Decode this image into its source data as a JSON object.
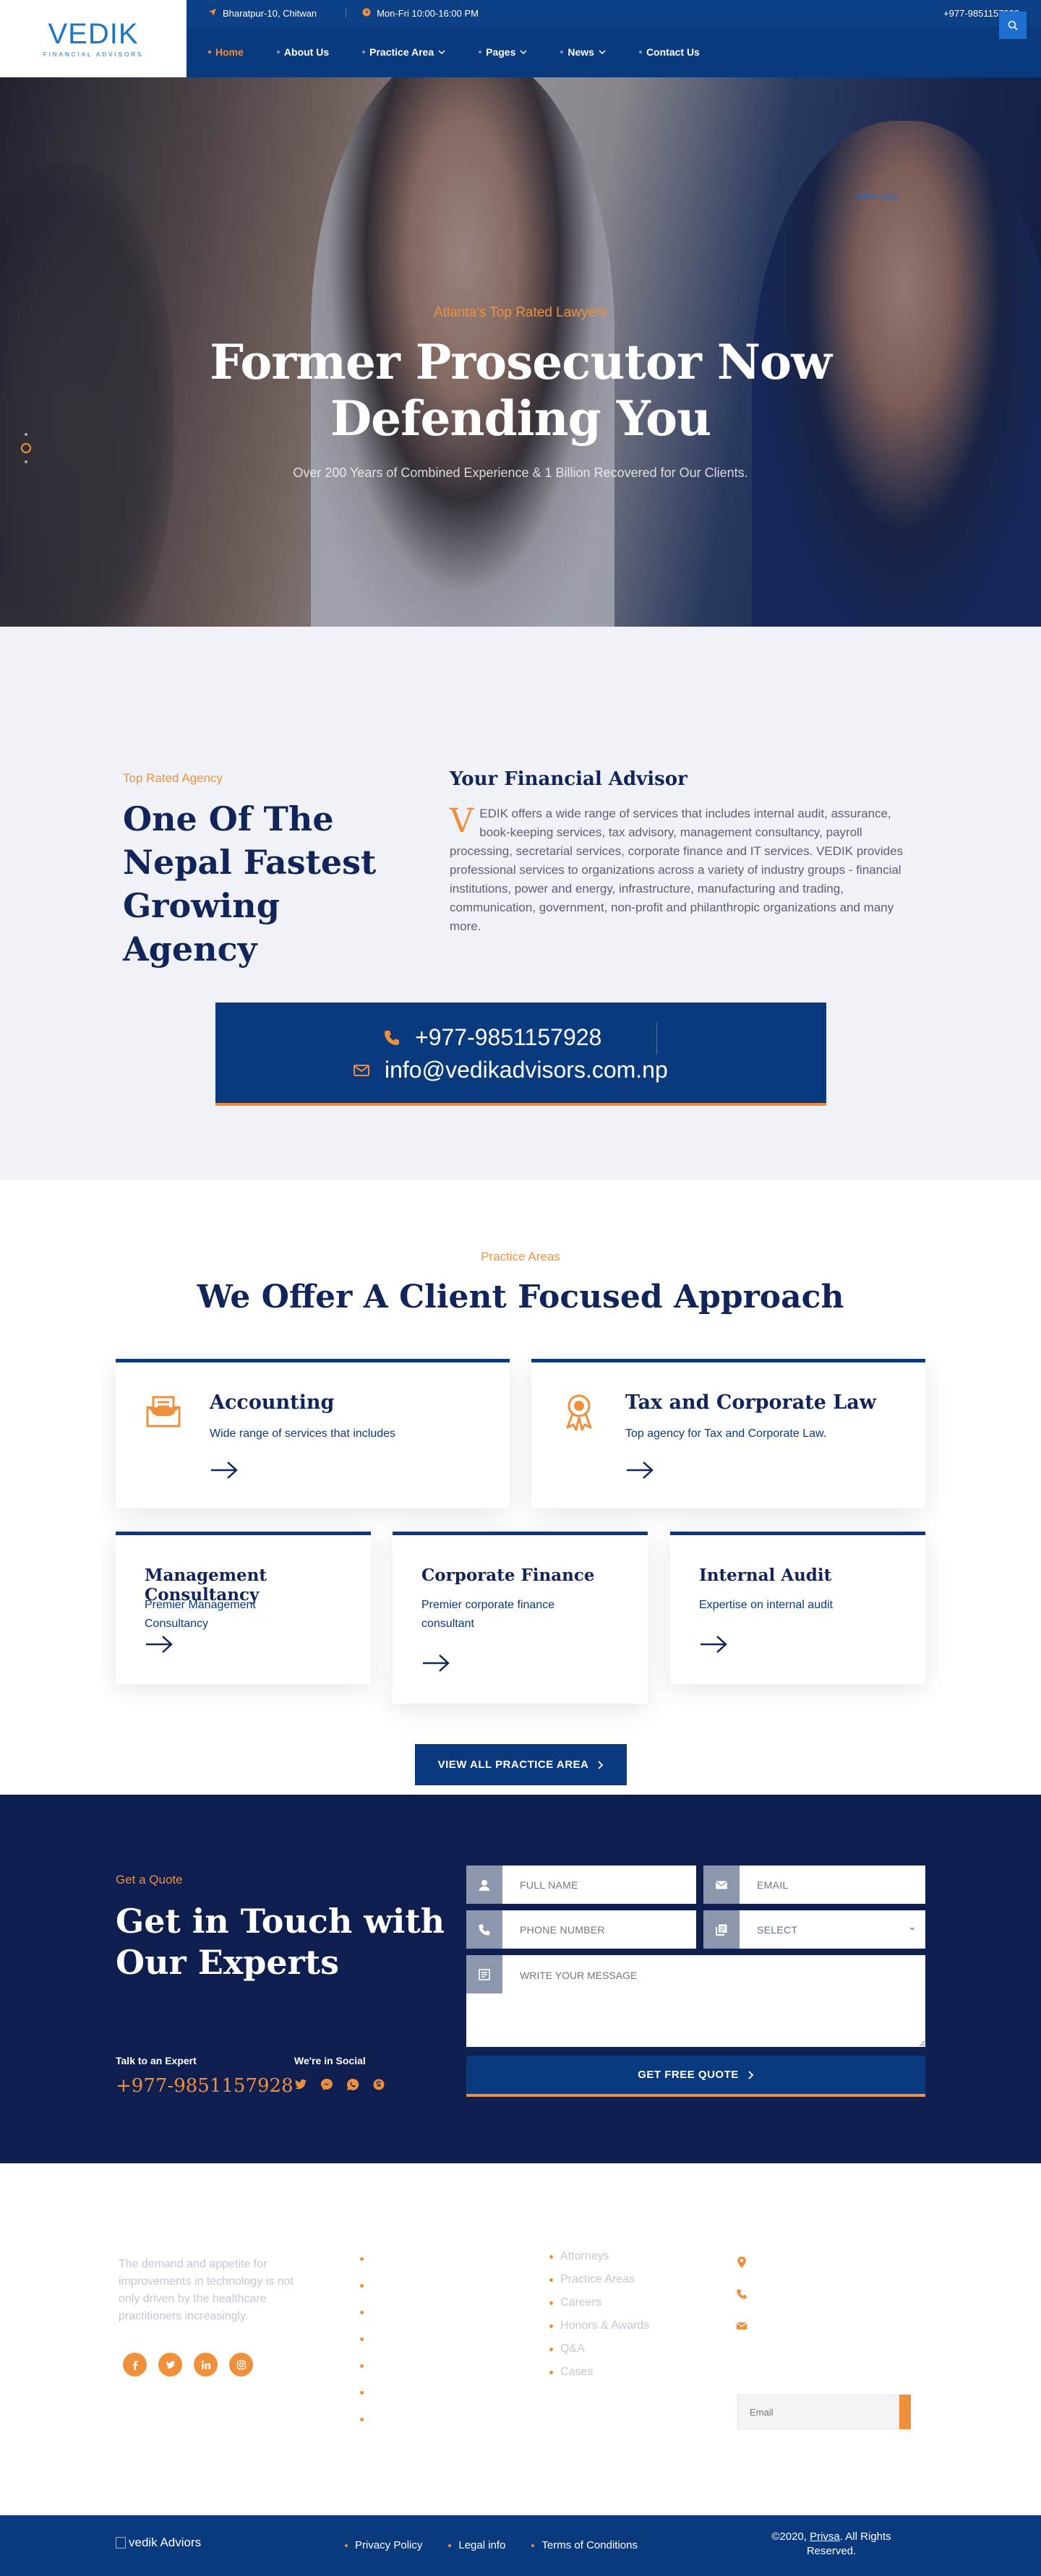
{
  "brand": {
    "logo_text": "VEDIK",
    "logo_sub": "FINANCIAL ADVISORS",
    "accent": "#f0903d",
    "primary": "#0a3a7e",
    "dark": "#0d1e4f"
  },
  "topbar": {
    "address": "Bharatpur-10, Chitwan",
    "hours": "Mon-Fri 10:00-16:00 PM",
    "phone": "+977-9851157928"
  },
  "nav": {
    "items": [
      {
        "label": "Home",
        "active": true
      },
      {
        "label": "About Us"
      },
      {
        "label": "Practice Area",
        "dropdown": true
      },
      {
        "label": "Pages",
        "dropdown": true
      },
      {
        "label": "News",
        "dropdown": true
      },
      {
        "label": "Contact Us"
      }
    ]
  },
  "hero": {
    "tagline": "Atlanta's Top Rated Lawyers",
    "title_line1": "Former Prosecutor Now",
    "title_line2": "Defending You",
    "subtitle": "Over 200 Years of Combined Experience & 1 Billion Recovered for Our Clients.",
    "image_alt": "slider-img"
  },
  "about": {
    "tag": "Top Rated Agency",
    "title": "One Of The Nepal Fastest Growing Agency",
    "advisor_title": "Your Financial Advisor",
    "dropcap": "V",
    "advisor_text": "EDIK offers a wide range of services that includes internal audit, assurance, book-keeping services, tax advisory, management consultancy, payroll processing, secretarial services, corporate finance and IT services. VEDIK provides professional services to organizations across a variety of industry groups - financial institutions, power and energy, infrastructure, manufacturing and trading, communication, government, non-profit and philanthropic organizations and many more.",
    "phone": "+977-9851157928",
    "email": "info@vedikadvisors.com.np"
  },
  "practice": {
    "tag": "Practice Areas",
    "title": "We Offer A Client Focused Approach",
    "cards": [
      {
        "title": "Accounting",
        "desc": "Wide range of services that includes"
      },
      {
        "title": "Tax and Corporate Law",
        "desc": "Top agency for Tax and Corporate Law."
      },
      {
        "title": "Management Consultancy",
        "desc": "Premier Management Consultancy"
      },
      {
        "title": "Corporate Finance",
        "desc": "Premier corporate finance consultant"
      },
      {
        "title": "Internal Audit",
        "desc": "Expertise on internal audit"
      }
    ],
    "view_all": "VIEW ALL PRACTICE AREA"
  },
  "quote": {
    "tag": "Get a Quote",
    "title": "Get in Touch with Our Experts",
    "talk_label": "Talk to an Expert",
    "social_label": "We're in Social",
    "phone": "+977-9851157928",
    "form": {
      "fullname_placeholder": "FULL NAME",
      "email_placeholder": "EMAIL",
      "phone_placeholder": "PHONE NUMBER",
      "select_value": "SELECT",
      "message_placeholder": "WRITE YOUR MESSAGE",
      "submit": "GET FREE QUOTE"
    }
  },
  "footer": {
    "about": "The demand and appetite for improvements in technology is not only driven by the healthcare practitioners increasingly.",
    "links": [
      "Attorneys",
      "Practice Areas",
      "Careers",
      "Honors & Awards",
      "Q&A",
      "Cases"
    ],
    "newsletter_placeholder": "Email"
  },
  "bottom": {
    "logo_alt": "vedik Adviors",
    "links": [
      "Privacy Policy",
      "Legal info",
      "Terms of Conditions"
    ],
    "copyright_pre": "©2020, ",
    "copyright_link": "Privsa",
    "copyright_post": ". All Rights Reserved."
  }
}
